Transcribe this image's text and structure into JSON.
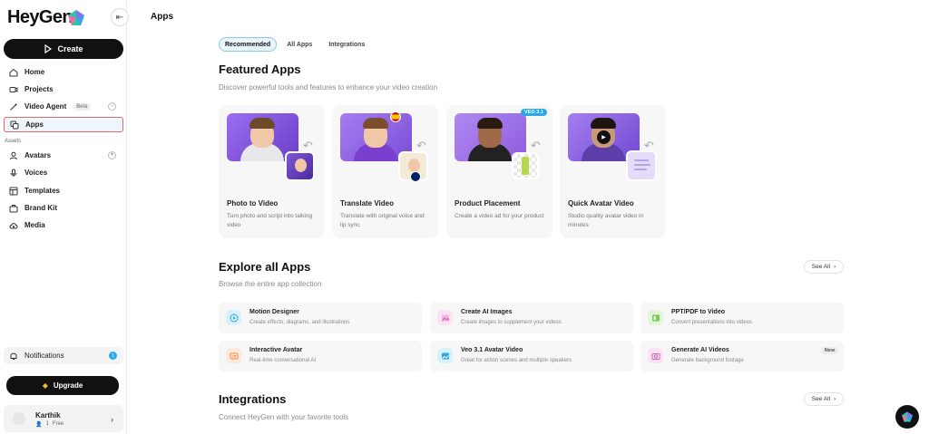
{
  "brand": {
    "name": "HeyGen"
  },
  "sidebar": {
    "create_label": "Create",
    "items": [
      {
        "label": "Home",
        "icon": "home-icon"
      },
      {
        "label": "Projects",
        "icon": "video-icon"
      },
      {
        "label": "Video Agent",
        "icon": "wand-icon",
        "badge": "Beta"
      },
      {
        "label": "Apps",
        "icon": "apps-icon",
        "active": true
      }
    ],
    "assets_label": "Assets",
    "asset_items": [
      {
        "label": "Avatars",
        "icon": "avatar-icon"
      },
      {
        "label": "Voices",
        "icon": "microphone-icon"
      },
      {
        "label": "Templates",
        "icon": "template-icon"
      },
      {
        "label": "Brand Kit",
        "icon": "brand-kit-icon"
      },
      {
        "label": "Media",
        "icon": "media-icon"
      }
    ],
    "notifications_label": "Notifications",
    "notifications_count": "1",
    "upgrade_label": "Upgrade",
    "user": {
      "name": "Karthik",
      "seats": "1",
      "plan": "Free"
    }
  },
  "main": {
    "title": "Apps",
    "tabs": [
      "Recommended",
      "All Apps",
      "Integrations"
    ],
    "featured": {
      "title": "Featured Apps",
      "subtitle": "Discover powerful tools and features to enhance your video creation",
      "cards": [
        {
          "title": "Photo to Video",
          "desc": "Turn photo and script into talking video"
        },
        {
          "title": "Translate Video",
          "desc": "Translate with original voice and lip sync"
        },
        {
          "title": "Product Placement",
          "desc": "Create a video ad for your product",
          "badge": "VEO 3.1"
        },
        {
          "title": "Quick Avatar Video",
          "desc": "Studio quality avatar video in minutes"
        }
      ]
    },
    "explore": {
      "title": "Explore all Apps",
      "subtitle": "Browse the entire app collection",
      "see_all": "See All",
      "apps": [
        {
          "title": "Motion Designer",
          "desc": "Create effects, diagrams, and illustrations",
          "icon": "play-circle-icon",
          "color": "#d9f1fb"
        },
        {
          "title": "Create AI Images",
          "desc": "Create images to supplement your videos",
          "icon": "image-icon",
          "color": "#fbe3f3"
        },
        {
          "title": "PPT/PDF to Video",
          "desc": "Convert presentations into videos",
          "icon": "presentation-icon",
          "color": "#e3f5d8"
        },
        {
          "title": "Interactive Avatar",
          "desc": "Real-time conversational AI",
          "icon": "chat-avatar-icon",
          "color": "#fde9dc"
        },
        {
          "title": "Veo 3.1 Avatar Video",
          "desc": "Great for action scenes and multiple speakers",
          "icon": "image-frame-icon",
          "color": "#d9f1fb"
        },
        {
          "title": "Generate AI Videos",
          "desc": "Generate background footage",
          "icon": "camera-icon",
          "color": "#fbe3f3",
          "badge": "New"
        }
      ]
    },
    "integrations": {
      "title": "Integrations",
      "subtitle": "Connect HeyGen with your favorite tools",
      "see_all": "See All"
    }
  }
}
